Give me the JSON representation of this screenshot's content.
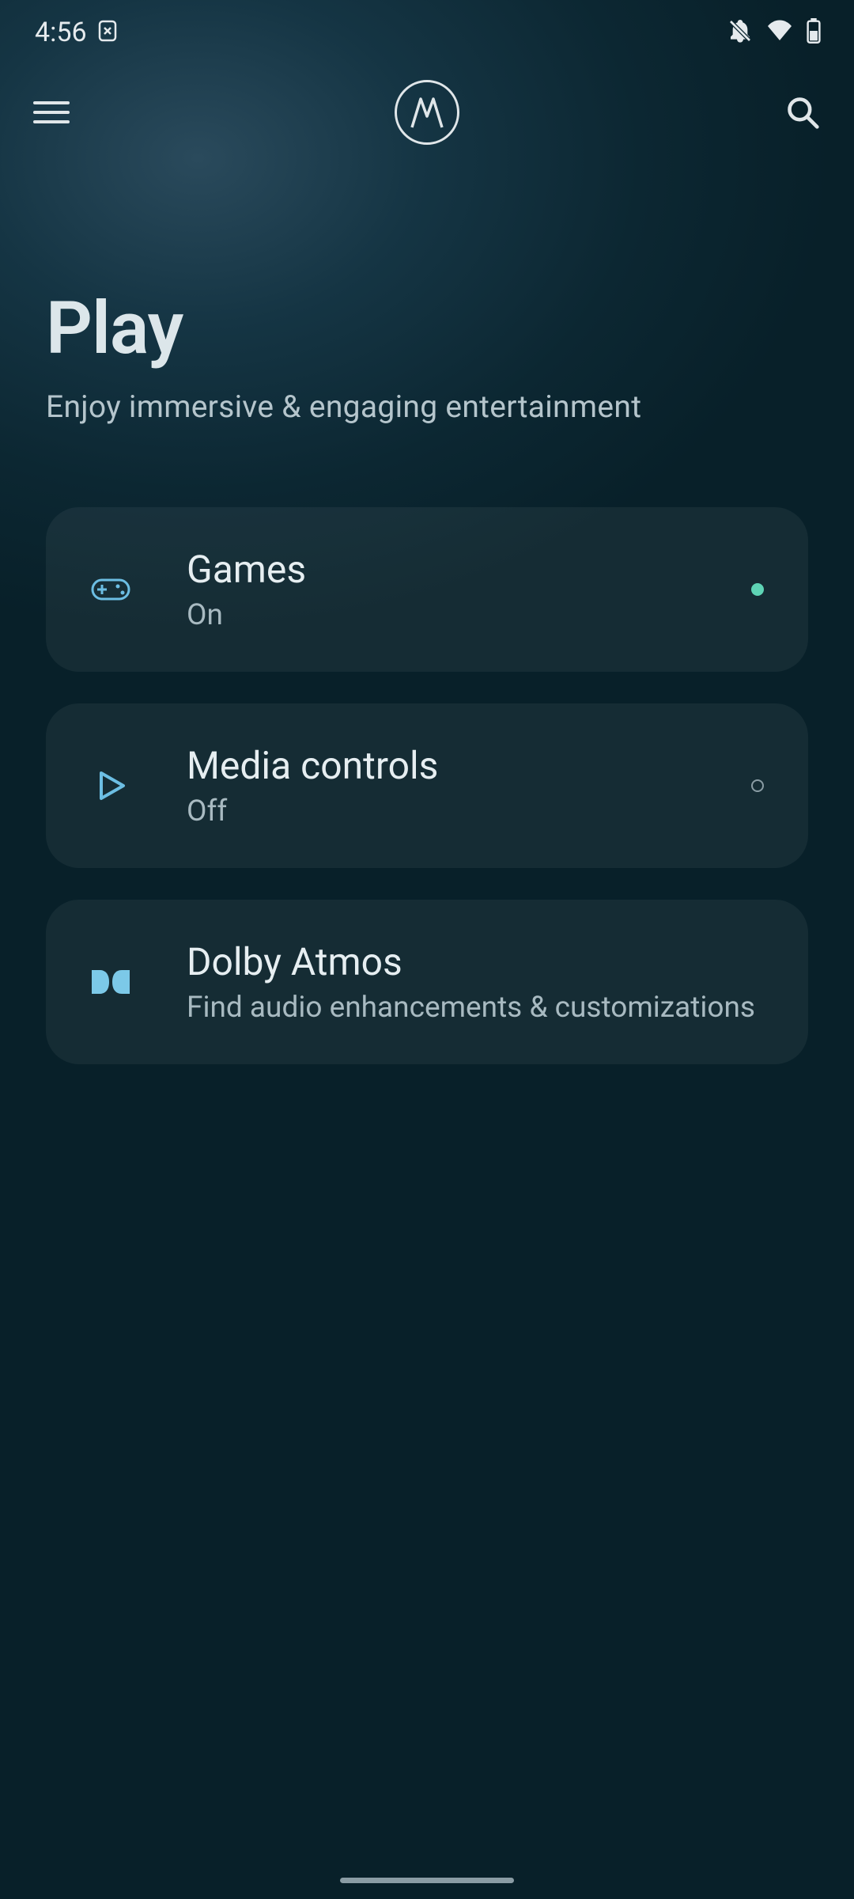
{
  "statusBar": {
    "time": "4:56"
  },
  "page": {
    "title": "Play",
    "subtitle": "Enjoy immersive & engaging entertainment"
  },
  "cards": [
    {
      "title": "Games",
      "subtitle": "On",
      "statusOn": true
    },
    {
      "title": "Media controls",
      "subtitle": "Off",
      "statusOn": false
    },
    {
      "title": "Dolby Atmos",
      "subtitle": "Find audio enhancements & customizations",
      "statusOn": null
    }
  ]
}
